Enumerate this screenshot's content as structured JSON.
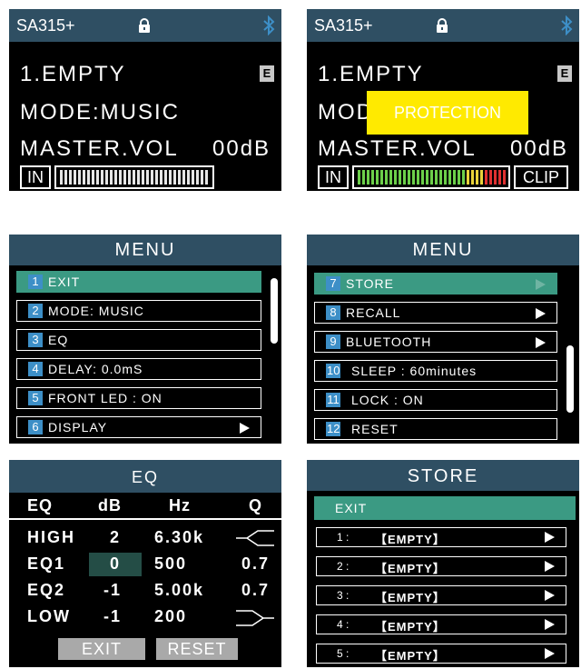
{
  "status": {
    "model": "SA315+",
    "lock_icon": "lock-icon",
    "bt_icon": "bluetooth-icon"
  },
  "home": {
    "preset": "1.EMPTY",
    "eq_badge": "E",
    "mode": "MODE:MUSIC",
    "master_label": "MASTER.VOL",
    "master_value": "00dB",
    "in_label": "IN",
    "clip_label": "CLIP",
    "protect_mode_partial": "MOD",
    "protection": "PROTECTION"
  },
  "menu1": {
    "title": "MENU",
    "items": [
      {
        "num": "1",
        "label": "EXIT"
      },
      {
        "num": "2",
        "label": "MODE:   MUSIC"
      },
      {
        "num": "3",
        "label": "EQ"
      },
      {
        "num": "4",
        "label": "DELAY: 0.0mS"
      },
      {
        "num": "5",
        "label": "FRONT LED :  ON"
      },
      {
        "num": "6",
        "label": "DISPLAY"
      }
    ]
  },
  "menu2": {
    "title": "MENU",
    "items": [
      {
        "num": "7",
        "label": "STORE"
      },
      {
        "num": "8",
        "label": "RECALL"
      },
      {
        "num": "9",
        "label": "BLUETOOTH"
      },
      {
        "num": "10",
        "label": "SLEEP : 60minutes"
      },
      {
        "num": "11",
        "label": "LOCK : ON"
      },
      {
        "num": "12",
        "label": "RESET"
      }
    ]
  },
  "eq": {
    "title": "EQ",
    "headers": [
      "EQ",
      "dB",
      "Hz",
      "Q"
    ],
    "rows": [
      {
        "band": "HIGH",
        "db": "2",
        "hz": "6.30k",
        "q": ""
      },
      {
        "band": "EQ1",
        "db": "0",
        "hz": "500",
        "q": "0.7"
      },
      {
        "band": "EQ2",
        "db": "-1",
        "hz": "5.00k",
        "q": "0.7"
      },
      {
        "band": "LOW",
        "db": "-1",
        "hz": "200",
        "q": ""
      }
    ],
    "exit_label": "EXIT",
    "reset_label": "RESET"
  },
  "store": {
    "title": "STORE",
    "exit_label": "EXIT",
    "items": [
      {
        "idx": "1 :",
        "name": "【EMPTY】"
      },
      {
        "idx": "2 :",
        "name": "【EMPTY】"
      },
      {
        "idx": "3 :",
        "name": "【EMPTY】"
      },
      {
        "idx": "4 :",
        "name": "【EMPTY】"
      },
      {
        "idx": "5 :",
        "name": "【EMPTY】"
      }
    ]
  },
  "colors": {
    "topbar": "#2f4f63",
    "highlight": "#3b9a83",
    "number_badge": "#3d8fc7",
    "warning": "#ffea00"
  }
}
